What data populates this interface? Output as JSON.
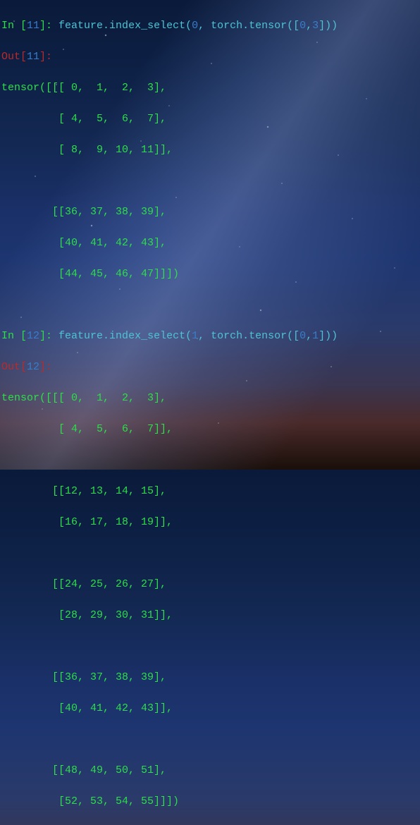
{
  "cells": [
    {
      "in_num": "11",
      "code_pre": "feature.index_select(",
      "arg0": "0",
      "code_mid": ", torch.tensor([",
      "arg1": "0",
      "arg2": "3",
      "code_post": "]))",
      "out_num": "11",
      "output_lines": [
        "tensor([[[ 0,  1,  2,  3],",
        "         [ 4,  5,  6,  7],",
        "         [ 8,  9, 10, 11]],",
        "",
        "        [[36, 37, 38, 39],",
        "         [40, 41, 42, 43],",
        "         [44, 45, 46, 47]]])"
      ]
    },
    {
      "in_num": "12",
      "code_pre": "feature.index_select(",
      "arg0": "1",
      "code_mid": ", torch.tensor([",
      "arg1": "0",
      "arg2": "1",
      "code_post": "]))",
      "out_num": "12",
      "output_lines": [
        "tensor([[[ 0,  1,  2,  3],",
        "         [ 4,  5,  6,  7]],",
        "",
        "        [[12, 13, 14, 15],",
        "         [16, 17, 18, 19]],",
        "",
        "        [[24, 25, 26, 27],",
        "         [28, 29, 30, 31]],",
        "",
        "        [[36, 37, 38, 39],",
        "         [40, 41, 42, 43]],",
        "",
        "        [[48, 49, 50, 51],",
        "         [52, 53, 54, 55]]])"
      ]
    }
  ],
  "labels": {
    "in_pre": "In [",
    "in_post": "]: ",
    "out_pre": "Out[",
    "out_post": "]:"
  }
}
